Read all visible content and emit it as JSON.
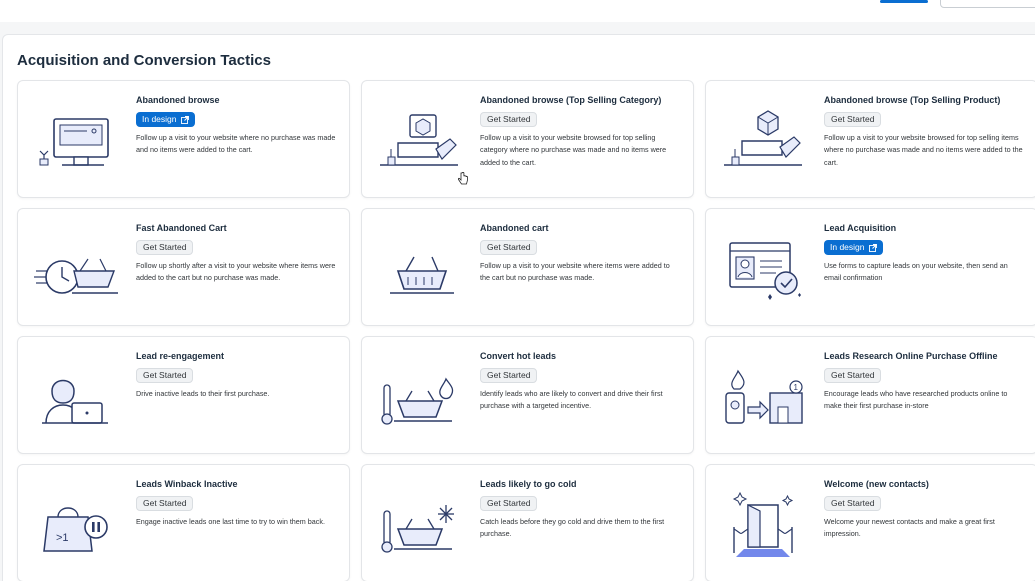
{
  "page": {
    "section_title": "Acquisition and Conversion Tactics"
  },
  "colors": {
    "accent": "#0a6ed1",
    "text": "#1d2d3e",
    "illustration_line": "#2b3a67",
    "illustration_fill": "#e8ecfb"
  },
  "cards": [
    {
      "title": "Abandoned browse",
      "status": "In design",
      "status_type": "design",
      "description": "Follow up a visit to your website where no purchase was made and no items were added to the cart.",
      "icon": "monitor-icon"
    },
    {
      "title": "Abandoned browse (Top Selling Category)",
      "status": "Get Started",
      "status_type": "started",
      "description": "Follow up a visit to your website browsed for top selling category where no purchase was made and no items were added to the cart.",
      "icon": "category-hand-icon"
    },
    {
      "title": "Abandoned browse (Top Selling Product)",
      "status": "Get Started",
      "status_type": "started",
      "description": "Follow up a visit to your website browsed for top selling items where no purchase was made and no items were added to the cart.",
      "icon": "product-hand-icon"
    },
    {
      "title": "Fast Abandoned Cart",
      "status": "Get Started",
      "status_type": "started",
      "description": "Follow up shortly after a visit to your website where items were added to the cart but no purchase was made.",
      "icon": "fast-cart-icon"
    },
    {
      "title": "Abandoned cart",
      "status": "Get Started",
      "status_type": "started",
      "description": "Follow up a visit to your website where items were added to the cart but no purchase was made.",
      "icon": "basket-icon"
    },
    {
      "title": "Lead Acquisition",
      "status": "In design",
      "status_type": "design",
      "description": "Use forms to capture leads on your website, then send an email confirmation",
      "icon": "form-check-icon"
    },
    {
      "title": "Lead re-engagement",
      "status": "Get Started",
      "status_type": "started",
      "description": "Drive inactive leads to their first purchase.",
      "icon": "person-laptop-icon"
    },
    {
      "title": "Convert hot leads",
      "status": "Get Started",
      "status_type": "started",
      "description": "Identify leads who are likely to convert and drive their first purchase with a targeted incentive.",
      "icon": "hot-basket-icon"
    },
    {
      "title": "Leads Research Online Purchase Offline",
      "status": "Get Started",
      "status_type": "started",
      "description": "Encourage leads who have researched products online to make their first purchase in-store",
      "icon": "phone-store-icon"
    },
    {
      "title": "Leads Winback Inactive",
      "status": "Get Started",
      "status_type": "started",
      "description": "Engage inactive leads one last time to try to win them back.",
      "icon": "shopping-bag-pause-icon"
    },
    {
      "title": "Leads likely to go cold",
      "status": "Get Started",
      "status_type": "started",
      "description": "Catch leads before they go cold and drive them to the first purchase.",
      "icon": "cold-basket-icon"
    },
    {
      "title": "Welcome (new contacts)",
      "status": "Get Started",
      "status_type": "started",
      "description": "Welcome your newest contacts and make a great first impression.",
      "icon": "welcome-door-icon"
    }
  ]
}
